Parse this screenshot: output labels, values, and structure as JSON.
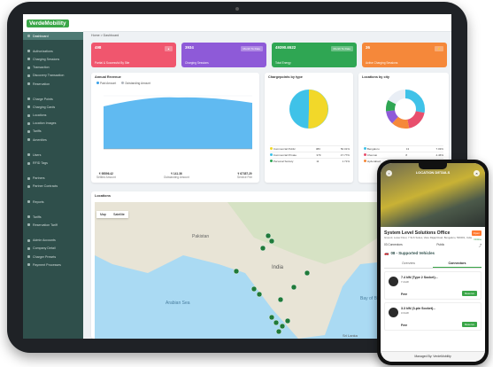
{
  "app": {
    "name": "VerdeMobility"
  },
  "sidebar": {
    "items": [
      {
        "label": "Dashboard"
      },
      {
        "label": "Authorizations"
      },
      {
        "label": "Charging Sessions"
      },
      {
        "label": "Transaction"
      },
      {
        "label": "Discovery Transaction"
      },
      {
        "label": "Reservation"
      },
      {
        "label": "Charge Points"
      },
      {
        "label": "Charging Cards"
      },
      {
        "label": "Locations"
      },
      {
        "label": "Location Images"
      },
      {
        "label": "Tariffs"
      },
      {
        "label": "Amenities"
      },
      {
        "label": "Users"
      },
      {
        "label": "RFID Tags"
      },
      {
        "label": "Partners"
      },
      {
        "label": "Partner Contracts"
      },
      {
        "label": "Reports"
      },
      {
        "label": "Tariffs"
      },
      {
        "label": "Reservation Tariff"
      },
      {
        "label": "Admin Accounts"
      },
      {
        "label": "Company Detail"
      },
      {
        "label": "Charger Presets"
      },
      {
        "label": "Payment Processes"
      }
    ]
  },
  "breadcrumb": "Home  >  Dashboard",
  "cards": [
    {
      "value": "498",
      "label": "Partial & Successful By Site",
      "chip": "",
      "color": "#f0566e"
    },
    {
      "value": "3934",
      "label": "Charging Sessions",
      "chip": "Month To Date",
      "color": "#8e5ad8"
    },
    {
      "value": "49390.6522",
      "label": "Total Energy",
      "chip": "Month To Date",
      "color": "#2fa653"
    },
    {
      "value": "36",
      "label": "Active Charging Sessions",
      "chip": "",
      "color": "#f5883a"
    }
  ],
  "revenue": {
    "title": "Annual Revenue",
    "legend": [
      "Paid Amount",
      "Outstanding Amount"
    ],
    "stats": [
      {
        "value": "₹ 95596.42",
        "label": "Settled Amount"
      },
      {
        "value": "₹ 141.36",
        "label": "Outstanding Amount"
      },
      {
        "value": "₹ 67357.29",
        "label": "Service Fee"
      }
    ]
  },
  "chargepoints": {
    "title": "Chargepoints by type",
    "rows": [
      {
        "label": "Commercial Public",
        "count": "383",
        "pct": "50.01%"
      },
      {
        "label": "Commercial Private",
        "count": "379",
        "pct": "47.77%"
      },
      {
        "label": "Personal Society",
        "count": "11",
        "pct": "1.71%"
      }
    ]
  },
  "locations_city": {
    "title": "Locations by city",
    "rows": [
      {
        "label": "Bengaluru",
        "count": "13",
        "pct": "7.03%"
      },
      {
        "label": "Chennai",
        "count": "8",
        "pct": "4.46%"
      },
      {
        "label": "Hyderabad",
        "count": "7",
        "pct": "3.91%"
      }
    ]
  },
  "map": {
    "title": "Locations",
    "tabs": [
      "Map",
      "Satellite"
    ],
    "labels": [
      "Pakistan",
      "India",
      "Sri Lanka",
      "Arabian Sea",
      "Bay of Bengal"
    ]
  },
  "phone": {
    "header": "LOCATION DETAILS",
    "title": "System Level Solutions Office",
    "address": "Ground, Lower Floor, 7 SLS Suites, Vasu Rajaji Road, Bengaluru, 560001, India",
    "badge": "Open",
    "status": "Online",
    "connectors": "03 Connectors",
    "access": "Public",
    "supported": "08 - Supported Vehicles",
    "tabs": [
      "Overview",
      "Connectors"
    ],
    "conns": [
      {
        "title": "7.4 kW (Type 2 Socket)...",
        "power": "7.4 kW",
        "price": "Free",
        "button": "Reserve"
      },
      {
        "title": "3.3 kW (3-pin Socket)...",
        "power": "3.3 kW",
        "price": "Free",
        "button": "Reserve"
      }
    ],
    "footer": "Managed By: VerdeMobility"
  }
}
